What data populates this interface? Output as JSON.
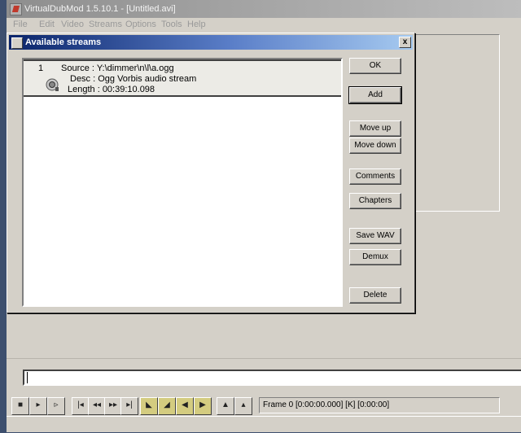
{
  "main_window": {
    "title": "VirtualDubMod 1.5.10.1 - [Untitled.avi]",
    "menu": [
      "File",
      "Edit",
      "Video",
      "Streams",
      "Options",
      "Tools",
      "Help"
    ]
  },
  "dialog": {
    "title": "Available streams",
    "close_label": "x",
    "streams": [
      {
        "index": "1",
        "source": "Source : Y:\\dimmer\\n\\l\\a.ogg",
        "desc": "Desc : Ogg Vorbis audio stream",
        "length": "Length : 00:39:10.098"
      }
    ],
    "buttons": {
      "ok": "OK",
      "add": "Add",
      "move_up": "Move up",
      "move_down": "Move down",
      "comments": "Comments",
      "chapters": "Chapters",
      "save_wav": "Save WAV",
      "demux": "Demux",
      "delete": "Delete"
    }
  },
  "toolbar": {
    "buttons": [
      "stop",
      "play-input",
      "play-output",
      "start",
      "prev-key",
      "prev-frame",
      "next-frame",
      "end",
      "mark-in",
      "mark-out",
      "scene-prev",
      "scene-next",
      "key-prev",
      "key-next"
    ],
    "frame_status": "Frame 0 [0:00:00.000] [K] [0:00:00]"
  }
}
